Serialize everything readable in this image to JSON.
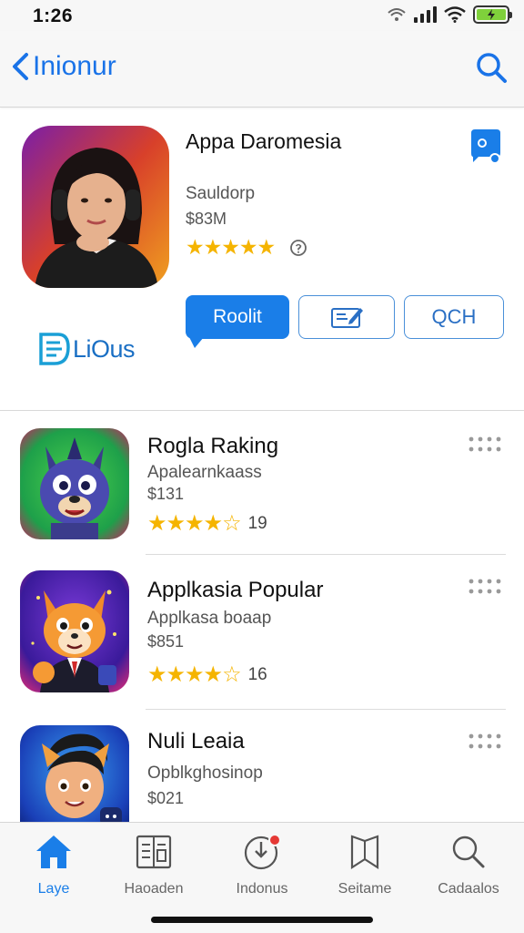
{
  "status_bar": {
    "time": "1:26"
  },
  "nav": {
    "back_label": "Inionur"
  },
  "featured": {
    "title": "Appa Daromesia",
    "subtitle": "Sauldorp",
    "price": "$83M",
    "rating_stars": 5,
    "stars": "★★★★★",
    "actions": {
      "primary_label": "Roolit",
      "tertiary_label": "QCH"
    },
    "brand": "LiOus"
  },
  "list": [
    {
      "title": "Rogla Raking",
      "subtitle": "Apalearnkaass",
      "price": "$131",
      "stars": "★★★★☆",
      "rating": 4.5,
      "count": "19"
    },
    {
      "title": "Applkasia Popular",
      "subtitle": "Applkasa boaap",
      "price": "$851",
      "stars": "★★★★☆",
      "rating": 4.5,
      "count": "16"
    },
    {
      "title": "Nuli Leaia",
      "subtitle": "Opblkghosinop",
      "price": "$021",
      "stars": "",
      "count": ""
    }
  ],
  "tabs": [
    {
      "label": "Laye",
      "icon": "home-icon",
      "active": true
    },
    {
      "label": "Haoaden",
      "icon": "document-icon",
      "active": false
    },
    {
      "label": "Indonus",
      "icon": "updates-icon",
      "active": false
    },
    {
      "label": "Seitame",
      "icon": "bookmark-icon",
      "active": false
    },
    {
      "label": "Cadaalos",
      "icon": "search-icon",
      "active": false
    }
  ],
  "colors": {
    "accent": "#1a7ee8",
    "star": "#f5b400",
    "badge": "#e53935"
  }
}
